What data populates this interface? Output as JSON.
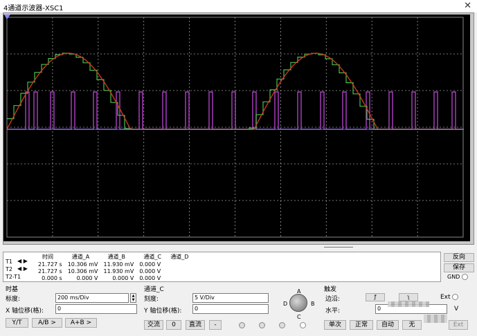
{
  "window": {
    "title": "4通道示波器-XSC1",
    "close_glyph": "✕"
  },
  "readout": {
    "columns": [
      "",
      "时间",
      "通道_A",
      "通道_B",
      "通道_C",
      "通道_D"
    ],
    "rows": [
      {
        "label": "T1",
        "time": "21.727 s",
        "a": "10.306 mV",
        "b": "11.930 mV",
        "c": "0.000 V",
        "d": ""
      },
      {
        "label": "T2",
        "time": "21.727 s",
        "a": "10.306 mV",
        "b": "11.930 mV",
        "c": "0.000 V",
        "d": ""
      },
      {
        "label": "T2-T1",
        "time": "0.000 s",
        "a": "0.000 V",
        "b": "0.000 V",
        "c": "0.000 V",
        "d": ""
      }
    ],
    "arrow_left": "◀",
    "arrow_right": "▶"
  },
  "side_buttons": {
    "reverse": "反向",
    "save": "保存",
    "gnd": "GND"
  },
  "timebase": {
    "title": "时基",
    "scale_label": "标度:",
    "scale_value": "200 ms/Div",
    "xpos_label": "X 轴位移(格):",
    "xpos_value": "0",
    "buttons": [
      "Y/T",
      "A/B >",
      "A+B >"
    ]
  },
  "channel": {
    "title": "通道_C",
    "scale_label": "刻度:",
    "scale_value": "5  V/Div",
    "ypos_label": "Y 轴位移(格):",
    "ypos_value": "0",
    "coupling_ac": "交流",
    "coupling_zero": "0",
    "coupling_dc": "直流",
    "coupling_minus": "-"
  },
  "selector": {
    "A": "A",
    "B": "B",
    "C": "C",
    "D": "D"
  },
  "trigger": {
    "title": "触发",
    "edge_label": "边沿:",
    "edge_rise": "ƒ",
    "edge_fall": "ʅ",
    "ext_label": "Ext",
    "level_label": "水平:",
    "level_value": "0",
    "level_unit": "V",
    "modes": [
      "单次",
      "正常",
      "自动",
      "无"
    ],
    "ext_button": "Ext"
  },
  "colors": {
    "screen": "#000000",
    "grid": "#a0a0a0",
    "sine": "#c83a1e",
    "step": "#4ac24a",
    "pulse": "#b040c8",
    "baseline": "#6ca0ff"
  },
  "icons": {
    "corner_marker": "triangle-cursor-icon",
    "close": "close-icon",
    "gnd_radio": "radio-icon"
  }
}
